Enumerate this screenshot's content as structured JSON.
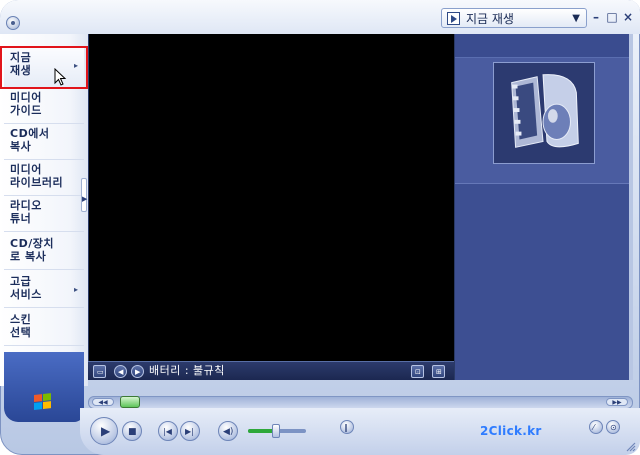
{
  "title_bar": {
    "current_view": "지금 재생",
    "dropdown_icon": "chevron-down-icon",
    "minimize_label": "–",
    "maximize_label": "□",
    "close_label": "×"
  },
  "sidebar": {
    "items": [
      {
        "label": "지금\n재생",
        "has_submenu": true
      },
      {
        "label": "미디어\n가이드",
        "has_submenu": false
      },
      {
        "label": "CD에서\n복사",
        "has_submenu": false
      },
      {
        "label": "미디어\n라이브러리",
        "has_submenu": false
      },
      {
        "label": "라디오\n튜너",
        "has_submenu": false
      },
      {
        "label": "CD/장치\n로 복사",
        "has_submenu": false
      },
      {
        "label": "고급\n서비스",
        "has_submenu": true
      },
      {
        "label": "스킨\n선택",
        "has_submenu": false
      }
    ],
    "submenu_arrow": "▸",
    "highlight_color": "#e1141b"
  },
  "video_bar": {
    "status": "배터리 : 불규칙"
  },
  "transport": {
    "watermark": "2Click.kr"
  },
  "colors": {
    "video_bg": "#000000",
    "info_panel": "#3d4f92",
    "accent": "#2f7cff"
  }
}
